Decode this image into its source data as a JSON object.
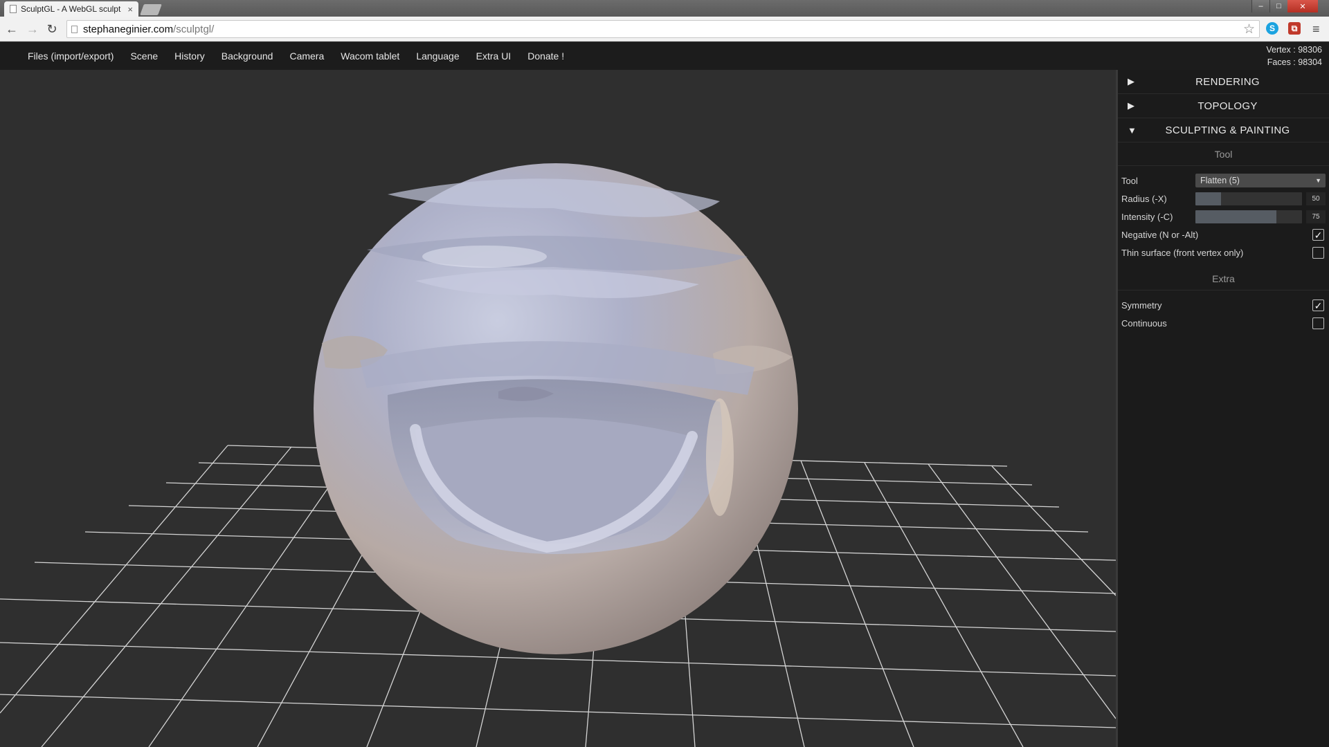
{
  "browser": {
    "tab_title": "SculptGL - A WebGL sculpt",
    "tab_close": "×",
    "url_host": "stephaneginier.com",
    "url_path": "/sculptgl/",
    "back": "←",
    "forward": "→",
    "reload": "↻",
    "star": "☆",
    "menu": "≡",
    "window": {
      "minimize": "–",
      "maximize": "□",
      "close": "✕"
    },
    "extensions": {
      "skype": "S",
      "pdf": "⧉"
    }
  },
  "menu": [
    "Files (import/export)",
    "Scene",
    "History",
    "Background",
    "Camera",
    "Wacom tablet",
    "Language",
    "Extra UI",
    "Donate !"
  ],
  "stats": {
    "vertex": "Vertex : 98306",
    "faces": "Faces : 98304"
  },
  "panel": {
    "sections": [
      {
        "arrow": "▶",
        "title": "RENDERING",
        "expanded": false
      },
      {
        "arrow": "▶",
        "title": "TOPOLOGY",
        "expanded": false
      },
      {
        "arrow": "▼",
        "title": "SCULPTING & PAINTING",
        "expanded": true
      }
    ],
    "tool_header": "Tool",
    "tool_label": "Tool",
    "tool_value": "Flatten (5)",
    "radius_label": "Radius (-X)",
    "radius_value": "50",
    "radius_fraction": 0.24,
    "intensity_label": "Intensity (-C)",
    "intensity_value": "75",
    "intensity_fraction": 0.76,
    "negative_label": "Negative (N or -Alt)",
    "negative_checked": true,
    "thin_label": "Thin surface (front vertex only)",
    "thin_checked": false,
    "extra_header": "Extra",
    "symmetry_label": "Symmetry",
    "symmetry_checked": true,
    "continuous_label": "Continuous",
    "continuous_checked": false
  },
  "colors": {
    "viewport_bg": "#2f2f2f",
    "panel_bg": "#1b1b1b",
    "menu_bg": "#1c1c1c",
    "grid": "#d9d9d9"
  }
}
